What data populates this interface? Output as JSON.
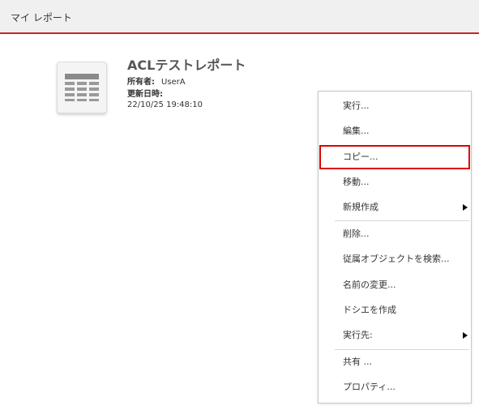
{
  "header": {
    "title": "マイ レポート"
  },
  "report": {
    "title": "ACLテストレポート",
    "owner_label": "所有者:",
    "owner_value": "UserA",
    "updated_label": "更新日時:",
    "updated_value": "22/10/25 19:48:10"
  },
  "menu": {
    "items": [
      {
        "label": "実行..."
      },
      {
        "label": "編集..."
      },
      {
        "label": "コピー..."
      },
      {
        "label": "移動..."
      },
      {
        "label": "新規作成"
      },
      {
        "label": "削除..."
      },
      {
        "label": "従属オブジェクトを検索..."
      },
      {
        "label": "名前の変更..."
      },
      {
        "label": "ドシエを作成"
      },
      {
        "label": "実行先:"
      },
      {
        "label": "共有 ..."
      },
      {
        "label": "プロパティ..."
      }
    ]
  },
  "colors": {
    "accent_border": "#cc2222",
    "highlight": "#e00000"
  }
}
